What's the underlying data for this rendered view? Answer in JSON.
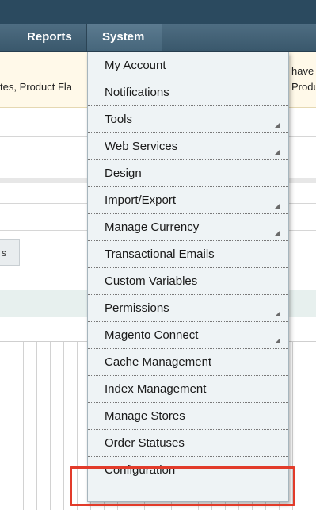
{
  "nav": {
    "reports": "Reports",
    "system": "System"
  },
  "notice": {
    "left_text": "tes, Product Fla",
    "right_text_1": "have",
    "right_text_2": "Produ"
  },
  "tab_label": "s",
  "system_menu": {
    "items": [
      {
        "label": "My Account",
        "has_submenu": false
      },
      {
        "label": "Notifications",
        "has_submenu": false
      },
      {
        "label": "Tools",
        "has_submenu": true
      },
      {
        "label": "Web Services",
        "has_submenu": true
      },
      {
        "label": "Design",
        "has_submenu": false
      },
      {
        "label": "Import/Export",
        "has_submenu": true
      },
      {
        "label": "Manage Currency",
        "has_submenu": true
      },
      {
        "label": "Transactional Emails",
        "has_submenu": false
      },
      {
        "label": "Custom Variables",
        "has_submenu": false
      },
      {
        "label": "Permissions",
        "has_submenu": true
      },
      {
        "label": "Magento Connect",
        "has_submenu": true
      },
      {
        "label": "Cache Management",
        "has_submenu": false
      },
      {
        "label": "Index Management",
        "has_submenu": false
      },
      {
        "label": "Manage Stores",
        "has_submenu": false
      },
      {
        "label": "Order Statuses",
        "has_submenu": false
      },
      {
        "label": "Configuration",
        "has_submenu": false,
        "highlighted": true
      }
    ]
  },
  "colors": {
    "navbar": "#3e5c71",
    "menu_bg": "#eef3f5",
    "highlight_border": "#e23b2a",
    "notice_bg": "#fff9e9"
  }
}
